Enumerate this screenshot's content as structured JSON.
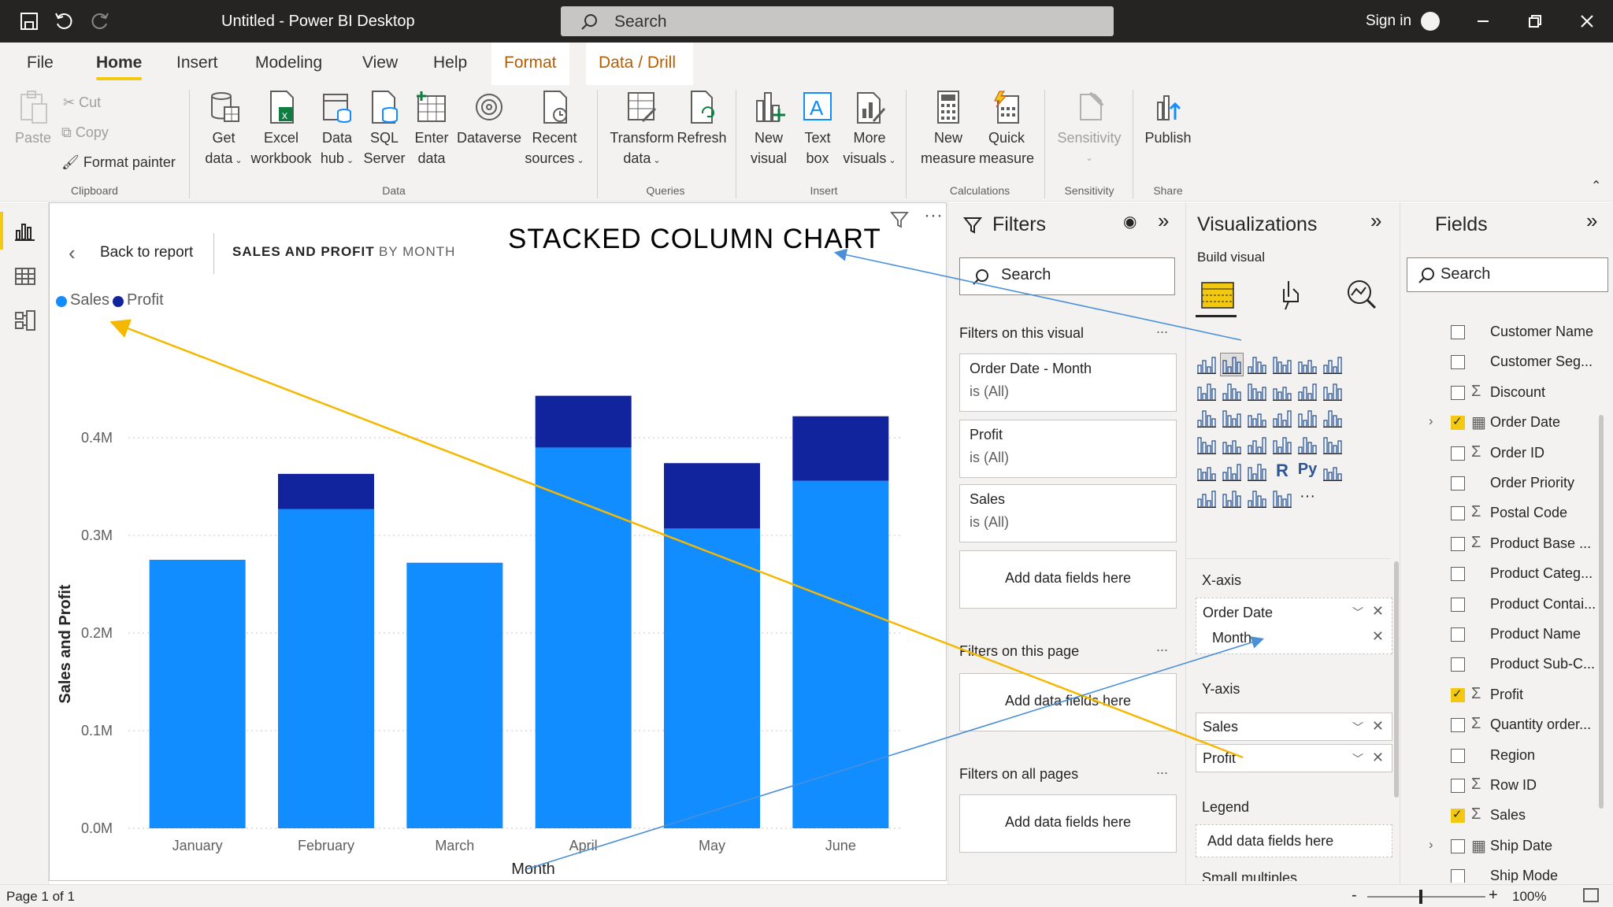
{
  "titlebar": {
    "app_title": "Untitled - Power BI Desktop",
    "search_placeholder": "Search",
    "sign_in": "Sign in"
  },
  "menu": {
    "tabs": [
      "File",
      "Home",
      "Insert",
      "Modeling",
      "View",
      "Help",
      "Format",
      "Data / Drill"
    ],
    "active": "Home"
  },
  "ribbon": {
    "paste": "Paste",
    "cut": "Cut",
    "copy": "Copy",
    "format_painter": "Format painter",
    "clipboard_group": "Clipboard",
    "get_data": [
      "Get",
      "data"
    ],
    "excel": [
      "Excel",
      "workbook"
    ],
    "data_hub": [
      "Data",
      "hub"
    ],
    "sql": [
      "SQL",
      "Server"
    ],
    "enter_data": [
      "Enter",
      "data"
    ],
    "dataverse": "Dataverse",
    "recent": [
      "Recent",
      "sources"
    ],
    "data_group": "Data",
    "transform": [
      "Transform",
      "data"
    ],
    "refresh": "Refresh",
    "queries_group": "Queries",
    "new_visual": [
      "New",
      "visual"
    ],
    "text_box": [
      "Text",
      "box"
    ],
    "more_visuals": [
      "More",
      "visuals"
    ],
    "insert_group": "Insert",
    "new_measure": [
      "New",
      "measure"
    ],
    "quick_measure": [
      "Quick",
      "measure"
    ],
    "calc_group": "Calculations",
    "sensitivity": "Sensitivity",
    "sensitivity_group": "Sensitivity",
    "publish": "Publish",
    "share_group": "Share"
  },
  "visual": {
    "back": "Back to report",
    "crumb_main": "SALES AND PROFIT",
    "crumb_sub": "BY MONTH",
    "annotation_title": "STACKED COLUMN CHART"
  },
  "chart_data": {
    "type": "bar",
    "stacked": true,
    "categories": [
      "January",
      "February",
      "March",
      "April",
      "May",
      "June"
    ],
    "series": [
      {
        "name": "Sales",
        "color": "#118dff",
        "values": [
          275000,
          327000,
          272000,
          390000,
          307000,
          356000
        ]
      },
      {
        "name": "Profit",
        "color": "#12239e",
        "values": [
          0,
          36000,
          0,
          53000,
          67000,
          66000
        ]
      }
    ],
    "xlabel": "Month",
    "ylabel": "Sales and Profit",
    "yticks": [
      "0.0M",
      "0.1M",
      "0.2M",
      "0.3M",
      "0.4M"
    ],
    "ylim": [
      0,
      450000
    ],
    "legend": "top-left"
  },
  "filters": {
    "title": "Filters",
    "search_placeholder": "Search",
    "on_visual": "Filters on this visual",
    "cards": [
      {
        "name": "Order Date - Month",
        "state": "is (All)"
      },
      {
        "name": "Profit",
        "state": "is (All)"
      },
      {
        "name": "Sales",
        "state": "is (All)"
      }
    ],
    "add_here": "Add data fields here",
    "on_page": "Filters on this page",
    "on_all": "Filters on all pages",
    "more": "..."
  },
  "viz": {
    "title": "Visualizations",
    "build": "Build visual",
    "xaxis": "X-axis",
    "xaxis_field": "Order Date",
    "xaxis_sub": "Month",
    "yaxis": "Y-axis",
    "yaxis_fields": [
      "Sales",
      "Profit"
    ],
    "legend": "Legend",
    "add_here": "Add data fields here",
    "small_multiples": "Small multiples"
  },
  "fields": {
    "title": "Fields",
    "search_placeholder": "Search",
    "items": [
      {
        "name": "Customer Name",
        "sigma": false,
        "checked": false,
        "table": false
      },
      {
        "name": "Customer Seg...",
        "sigma": false,
        "checked": false,
        "table": false
      },
      {
        "name": "Discount",
        "sigma": true,
        "checked": false,
        "table": false
      },
      {
        "name": "Order Date",
        "sigma": false,
        "checked": true,
        "table": true
      },
      {
        "name": "Order ID",
        "sigma": true,
        "checked": false,
        "table": false
      },
      {
        "name": "Order Priority",
        "sigma": false,
        "checked": false,
        "table": false
      },
      {
        "name": "Postal Code",
        "sigma": true,
        "checked": false,
        "table": false
      },
      {
        "name": "Product Base ...",
        "sigma": true,
        "checked": false,
        "table": false
      },
      {
        "name": "Product Categ...",
        "sigma": false,
        "checked": false,
        "table": false
      },
      {
        "name": "Product Contai...",
        "sigma": false,
        "checked": false,
        "table": false
      },
      {
        "name": "Product Name",
        "sigma": false,
        "checked": false,
        "table": false
      },
      {
        "name": "Product Sub-C...",
        "sigma": false,
        "checked": false,
        "table": false
      },
      {
        "name": "Profit",
        "sigma": true,
        "checked": true,
        "table": false
      },
      {
        "name": "Quantity order...",
        "sigma": true,
        "checked": false,
        "table": false
      },
      {
        "name": "Region",
        "sigma": false,
        "checked": false,
        "table": false
      },
      {
        "name": "Row ID",
        "sigma": true,
        "checked": false,
        "table": false
      },
      {
        "name": "Sales",
        "sigma": true,
        "checked": true,
        "table": false
      },
      {
        "name": "Ship Date",
        "sigma": false,
        "checked": false,
        "table": true
      },
      {
        "name": "Ship Mode",
        "sigma": false,
        "checked": false,
        "table": false
      }
    ]
  },
  "status": {
    "page": "Page 1 of 1",
    "zoom": "100%"
  }
}
